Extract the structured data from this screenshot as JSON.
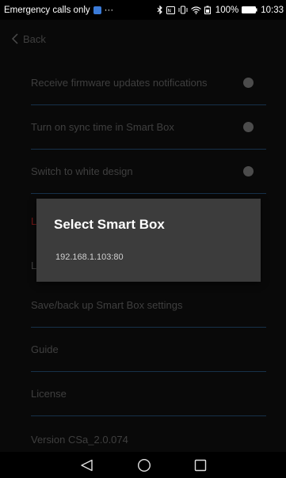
{
  "status_bar": {
    "carrier_text": "Emergency calls only",
    "ellipsis": "···",
    "battery_percent": "100%",
    "time": "10:33",
    "icons": [
      "app-notification-icon",
      "bluetooth-icon",
      "nfc-icon",
      "vibrate-icon",
      "wifi-icon",
      "battery-saver-icon",
      "battery-icon"
    ]
  },
  "header": {
    "back_label": "Back"
  },
  "settings": {
    "items": [
      {
        "label": "Receive firmware updates notifications",
        "has_toggle": true,
        "toggle_on": false
      },
      {
        "label": "Turn on sync time in Smart Box",
        "has_toggle": true,
        "toggle_on": false
      },
      {
        "label": "Switch to white design",
        "has_toggle": true,
        "toggle_on": false
      },
      {
        "label": "Save/back up Smart Box settings",
        "has_toggle": false
      },
      {
        "label": "Guide",
        "has_toggle": false
      },
      {
        "label": "License",
        "has_toggle": false
      },
      {
        "label": "Version CSa_2.0.074",
        "has_toggle": false
      }
    ],
    "hidden_row_peeks": [
      "L",
      "L"
    ]
  },
  "dialog": {
    "title": "Select Smart Box",
    "options": [
      "192.168.1.103:80"
    ]
  },
  "colors": {
    "background": "#0b0b0b",
    "divider": "#1c3a57",
    "dialog": "#3c3c3c",
    "text_dim": "#4a4a4a",
    "accent_red": "#8a1c1c",
    "app_badge": "#3b7bd8"
  },
  "nav_bar": {
    "buttons": [
      "back-triangle-icon",
      "home-circle-icon",
      "recents-square-icon"
    ]
  }
}
